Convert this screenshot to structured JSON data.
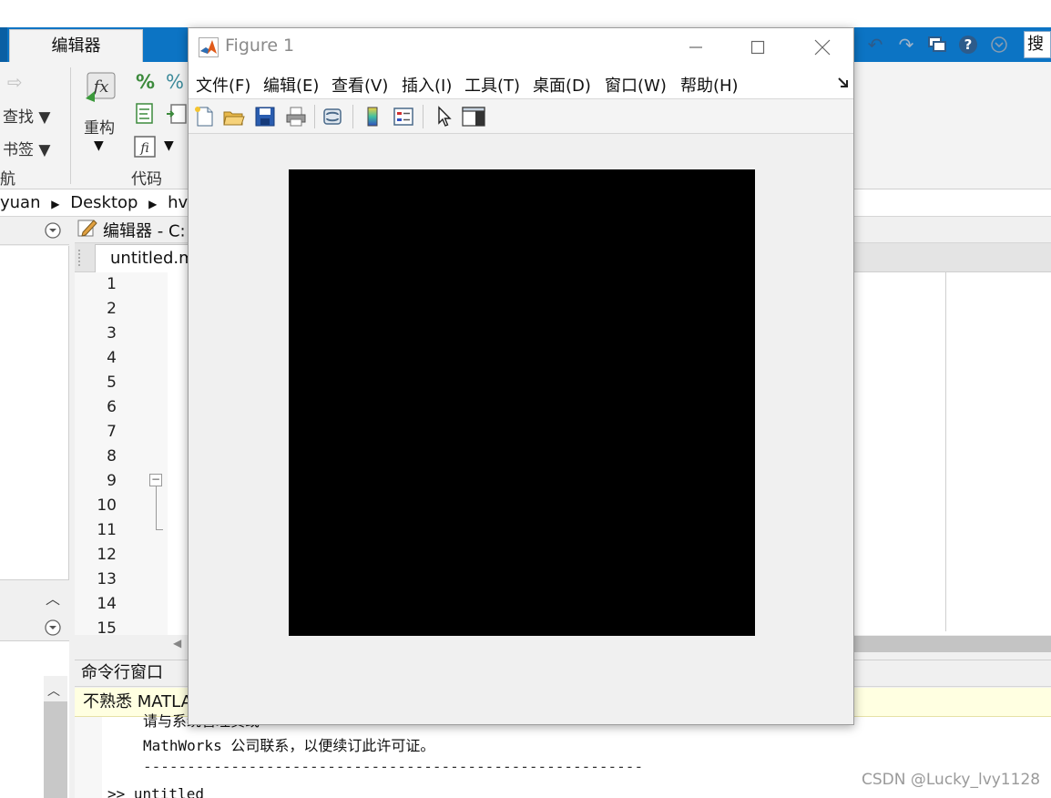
{
  "matlab": {
    "ribbon": {
      "active_tab": "编辑器",
      "navigate": {
        "find_label": "查找",
        "bookmark_label": "书签",
        "group_label": "航"
      },
      "code": {
        "refactor_label": "重构",
        "group_label": "代码"
      }
    },
    "search": {
      "placeholder": "搜索"
    },
    "address": {
      "segment_prefix": "yuan",
      "segments": [
        "Desktop",
        "hvs"
      ]
    },
    "editor": {
      "header": "编辑器 - C:",
      "tab_label": "untitled.m",
      "line_numbers": [
        "1",
        "2",
        "3",
        "4",
        "5",
        "6",
        "7",
        "8",
        "9",
        "10",
        "11",
        "12",
        "13",
        "14",
        "15"
      ]
    },
    "command_window": {
      "title": "命令行窗口",
      "banner": "不熟悉 MATLAB?",
      "lines": [
        "请与系统管理员或",
        "MathWorks 公司联系，以便续订此许可证。",
        "---------------------------------------------------------",
        ">> untitled"
      ]
    },
    "watermark": "CSDN @Lucky_lvy1128"
  },
  "figure": {
    "title": "Figure 1",
    "menu": [
      "文件(F)",
      "编辑(E)",
      "查看(V)",
      "插入(I)",
      "工具(T)",
      "桌面(D)",
      "窗口(W)",
      "帮助(H)"
    ],
    "axes_color": "#000000"
  },
  "colors": {
    "ribbon_blue": "#0c74c4",
    "banner_yellow": "#ffffe1"
  }
}
